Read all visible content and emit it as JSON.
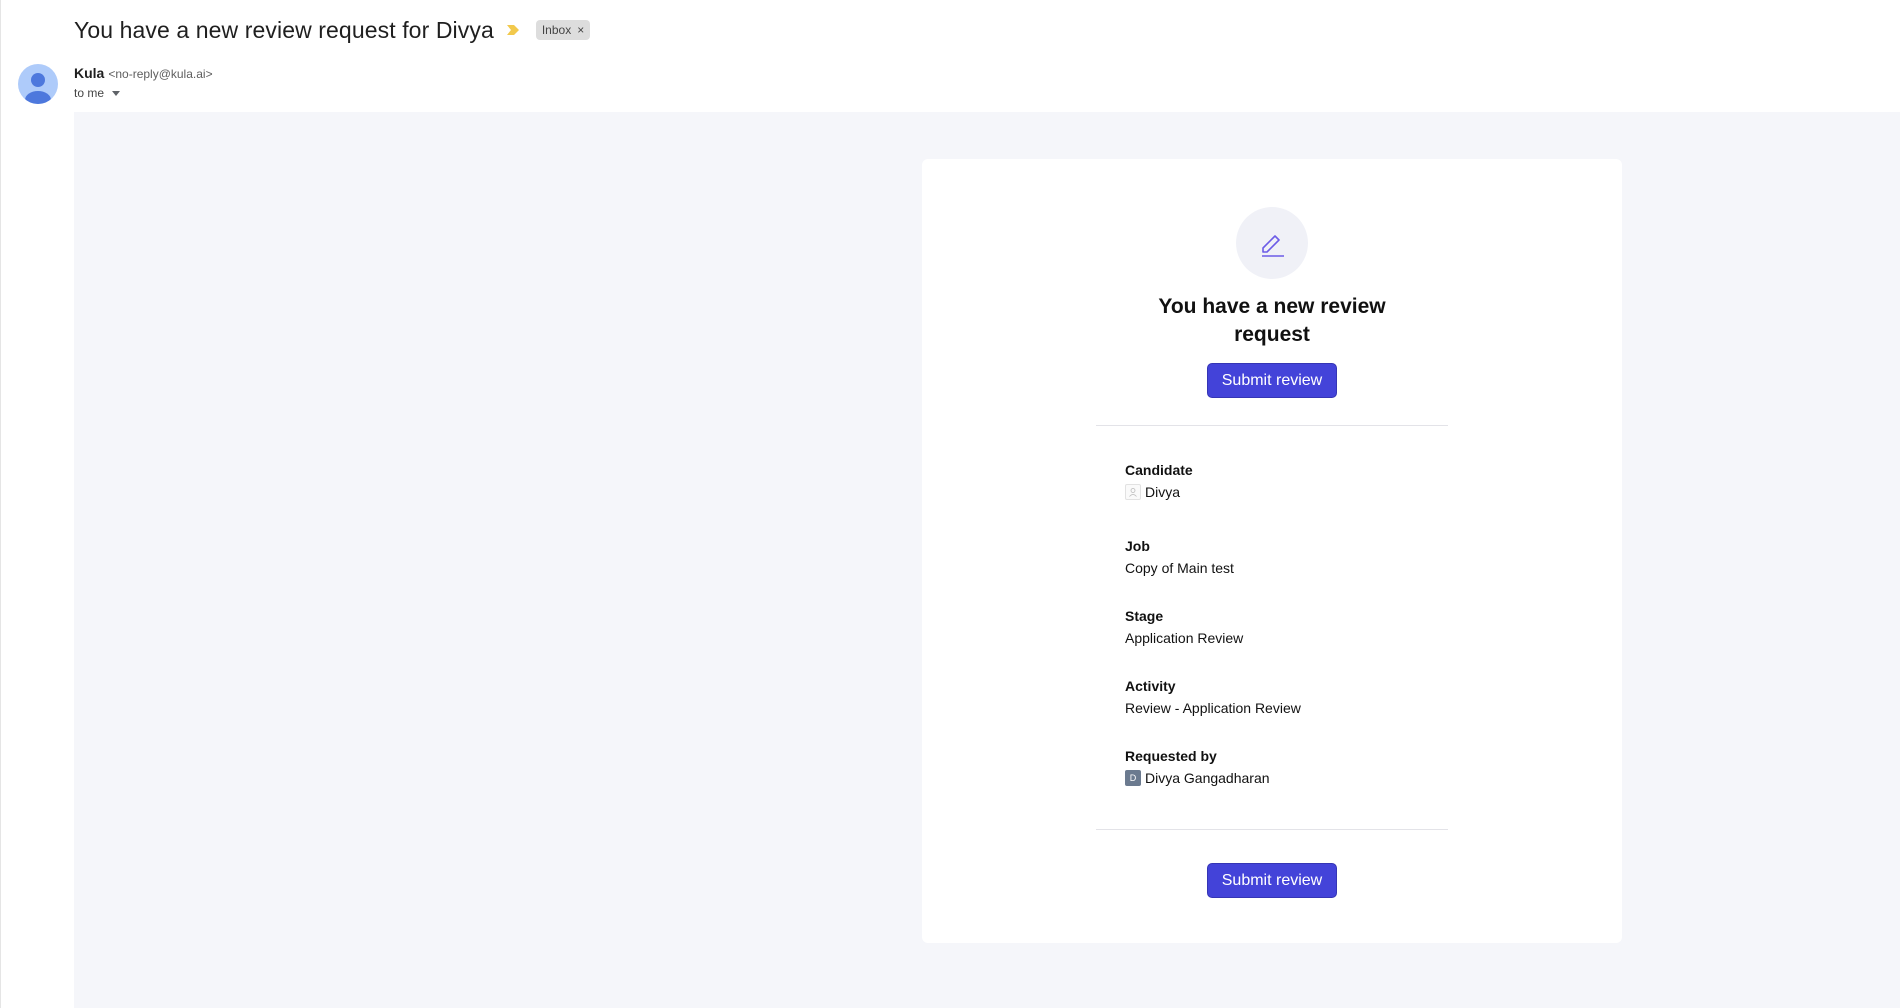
{
  "email": {
    "subject": "You have a new review request for Divya",
    "label_chip": "Inbox",
    "label_close": "×",
    "sender_name": "Kula",
    "sender_email": "<no-reply@kula.ai>",
    "recipient": "to me"
  },
  "card": {
    "title": "You have a new review request",
    "submit_label": "Submit review",
    "fields": [
      {
        "label": "Candidate",
        "value": "Divya"
      },
      {
        "label": "Job",
        "value": "Copy of Main test"
      },
      {
        "label": "Stage",
        "value": "Application Review"
      },
      {
        "label": "Activity",
        "value": "Review - Application Review"
      },
      {
        "label": "Requested by",
        "value": "Divya Gangadharan",
        "avatar_initial": "D"
      }
    ]
  },
  "colors": {
    "accent": "#4343d9",
    "body_background": "#f5f6fa",
    "importance": "#f2c94c"
  },
  "icons": [
    "importance-marker-icon",
    "close-icon",
    "user-avatar-icon",
    "chevron-down-icon",
    "edit-pen-icon",
    "broken-image-icon"
  ]
}
